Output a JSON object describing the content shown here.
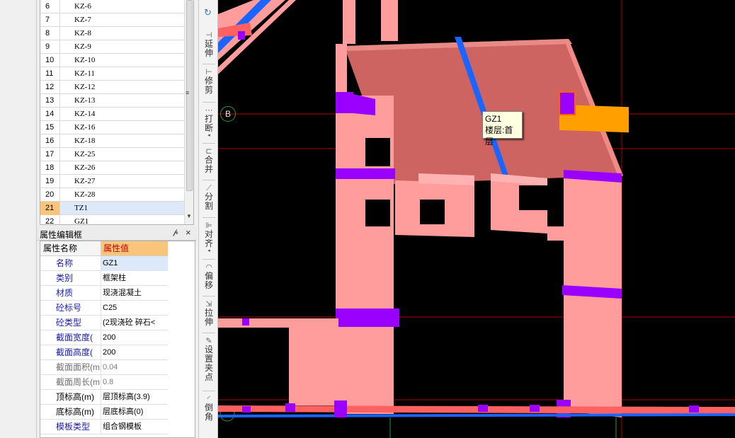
{
  "component_list": {
    "rows": [
      {
        "num": "6",
        "name": "KZ-6"
      },
      {
        "num": "7",
        "name": "KZ-7"
      },
      {
        "num": "8",
        "name": "KZ-8"
      },
      {
        "num": "9",
        "name": "KZ-9"
      },
      {
        "num": "10",
        "name": "KZ-10"
      },
      {
        "num": "11",
        "name": "KZ-11"
      },
      {
        "num": "12",
        "name": "KZ-12"
      },
      {
        "num": "13",
        "name": "KZ-13"
      },
      {
        "num": "14",
        "name": "KZ-14"
      },
      {
        "num": "15",
        "name": "KZ-16"
      },
      {
        "num": "16",
        "name": "KZ-18"
      },
      {
        "num": "17",
        "name": "KZ-25"
      },
      {
        "num": "18",
        "name": "KZ-26"
      },
      {
        "num": "19",
        "name": "KZ-27"
      },
      {
        "num": "20",
        "name": "KZ-28"
      },
      {
        "num": "21",
        "name": "TZ1"
      },
      {
        "num": "22",
        "name": "GZ1"
      }
    ],
    "selected_index": 15
  },
  "property_panel": {
    "title": "属性编辑框",
    "pin_icon": "pin-icon",
    "close_icon": "close-icon",
    "header_name": "属性名称",
    "header_value": "属性值",
    "rows": [
      {
        "name": "名称",
        "value": "GZ1",
        "style": "normal"
      },
      {
        "name": "类别",
        "value": "框架柱",
        "style": "normal"
      },
      {
        "name": "材质",
        "value": "现浇混凝土",
        "style": "normal"
      },
      {
        "name": "砼标号",
        "value": "C25",
        "style": "normal"
      },
      {
        "name": "砼类型",
        "value": "(2现浇砼 碎石<",
        "style": "normal"
      },
      {
        "name": "截面宽度(",
        "value": "200",
        "style": "normal"
      },
      {
        "name": "截面高度(",
        "value": "200",
        "style": "normal"
      },
      {
        "name": "截面面积(m",
        "value": "0.04",
        "style": "gray"
      },
      {
        "name": "截面周长(m",
        "value": "0.8",
        "style": "gray"
      },
      {
        "name": "顶标高(m)",
        "value": "层顶标高(3.9)",
        "style": "black"
      },
      {
        "name": "底标高(m)",
        "value": "层底标高(0)",
        "style": "black"
      },
      {
        "name": "模板类型",
        "value": "组合钢模板",
        "style": "normal"
      }
    ]
  },
  "toolbar": {
    "tools": [
      {
        "label": "延伸",
        "icon": "extend-icon"
      },
      {
        "label": "修剪",
        "icon": "trim-icon"
      },
      {
        "label": "打断",
        "icon": "break-icon"
      },
      {
        "label": "合并",
        "icon": "merge-icon"
      },
      {
        "label": "分割",
        "icon": "split-icon"
      },
      {
        "label": "对齐",
        "icon": "align-icon"
      },
      {
        "label": "偏移",
        "icon": "offset-icon"
      },
      {
        "label": "拉伸",
        "icon": "stretch-icon"
      },
      {
        "label": "设置夹点",
        "icon": "grip-point-icon"
      },
      {
        "label": "倒角",
        "icon": "chamfer-icon"
      }
    ]
  },
  "viewport": {
    "axis_label": "B",
    "tooltip": {
      "line1": "GZ1",
      "line2": "楼层:首层"
    },
    "colors": {
      "column": "#ff9c9c",
      "column_side": "#f08080",
      "slab": "#cd6461",
      "rebar_band": "#9a00ff",
      "blue_member": "#1b64ff",
      "orange_member": "#ffa000",
      "grid_red": "#b00000",
      "axis_green": "#1f9e3a"
    }
  }
}
